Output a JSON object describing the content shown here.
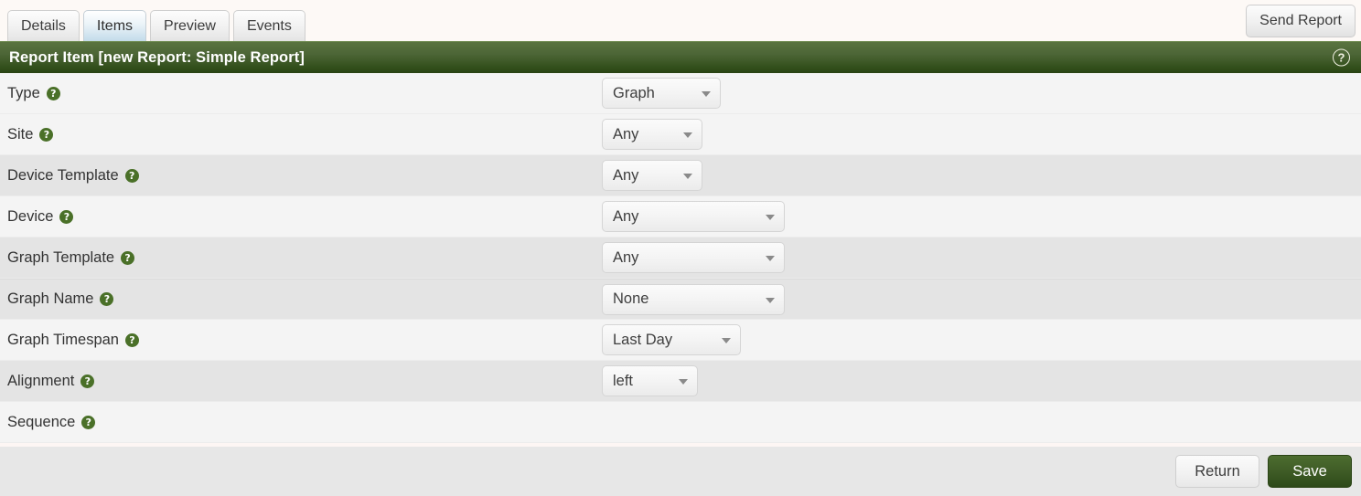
{
  "tabs": [
    {
      "label": "Details",
      "active": false
    },
    {
      "label": "Items",
      "active": true
    },
    {
      "label": "Preview",
      "active": false
    },
    {
      "label": "Events",
      "active": false
    }
  ],
  "toolbar": {
    "send_report_label": "Send Report"
  },
  "header": {
    "title": "Report Item [new Report: Simple Report]",
    "help_icon": "question-circle-icon",
    "help_glyph": "?"
  },
  "form": {
    "help_glyph": "?",
    "rows": [
      {
        "label": "Type",
        "stripe": "light",
        "control": "select",
        "value": "Graph",
        "width": "w-graph"
      },
      {
        "label": "Site",
        "stripe": "light",
        "control": "select",
        "value": "Any",
        "width": "w-any-sm"
      },
      {
        "label": "Device Template",
        "stripe": "dark",
        "control": "select",
        "value": "Any",
        "width": "w-any-sm"
      },
      {
        "label": "Device",
        "stripe": "light",
        "control": "select",
        "value": "Any",
        "width": "w-any-lg"
      },
      {
        "label": "Graph Template",
        "stripe": "dark",
        "control": "select",
        "value": "Any",
        "width": "w-any-lg"
      },
      {
        "label": "Graph Name",
        "stripe": "dark",
        "control": "select",
        "value": "None",
        "width": "w-none"
      },
      {
        "label": "Graph Timespan",
        "stripe": "light",
        "control": "select",
        "value": "Last Day",
        "width": "w-lastday"
      },
      {
        "label": "Alignment",
        "stripe": "dark",
        "control": "select",
        "value": "left",
        "width": "w-left"
      },
      {
        "label": "Sequence",
        "stripe": "light",
        "control": "none",
        "value": "",
        "width": ""
      }
    ]
  },
  "footer": {
    "return_label": "Return",
    "save_label": "Save"
  },
  "colors": {
    "header_green_top": "#5a7440",
    "header_green_bottom": "#294313",
    "save_green": "#3f5c26",
    "help_icon_green": "#4a7028",
    "active_tab_blue": "#c3dbea",
    "row_light": "#f4f4f4",
    "row_dark": "#e4e4e4"
  }
}
